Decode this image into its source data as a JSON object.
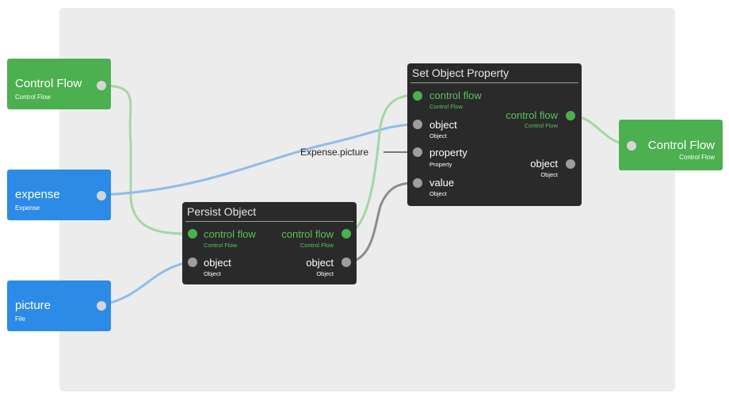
{
  "inputs": [
    {
      "title": "Control Flow",
      "subtitle": "Control Flow",
      "color": "#4caf50"
    },
    {
      "title": "expense",
      "subtitle": "Expense",
      "color": "#2b8be6"
    },
    {
      "title": "picture",
      "subtitle": "File",
      "color": "#2b8be6"
    }
  ],
  "output": {
    "title": "Control Flow",
    "subtitle": "Control Flow",
    "color": "#4caf50"
  },
  "persist": {
    "title": "Persist Object",
    "in_ports": [
      {
        "label": "control flow",
        "sub": "Control Flow"
      },
      {
        "label": "object",
        "sub": "Object"
      }
    ],
    "out_ports": [
      {
        "label": "control flow",
        "sub": "Control Flow"
      },
      {
        "label": "object",
        "sub": "Object"
      }
    ]
  },
  "setprop": {
    "title": "Set Object Property",
    "in_ports": [
      {
        "label": "control flow",
        "sub": "Control Flow"
      },
      {
        "label": "object",
        "sub": "Object"
      },
      {
        "label": "property",
        "sub": "Property"
      },
      {
        "label": "value",
        "sub": "Object"
      }
    ],
    "out_ports": [
      {
        "label": "control flow",
        "sub": "Control Flow"
      },
      {
        "label": "object",
        "sub": "Object"
      }
    ]
  },
  "constant": "Expense.picture",
  "colors": {
    "control_flow": "#4caf50",
    "data": "#2b8be6",
    "wire_green": "#a3d7a4",
    "wire_blue": "#8fbde8",
    "wire_gray": "#8c8c8c",
    "node_bg": "#2a2a2a"
  }
}
